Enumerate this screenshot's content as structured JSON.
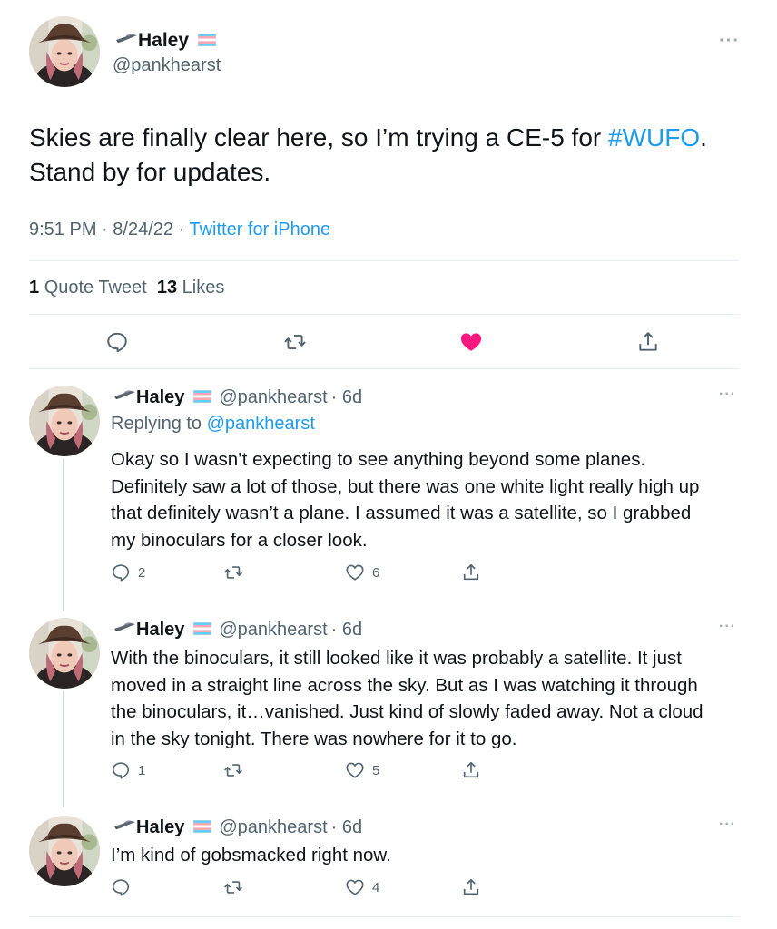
{
  "main_tweet": {
    "name": "Haley",
    "handle": "@pankhearst",
    "text_before": "Skies are finally clear here, so I’m trying a CE-5 for ",
    "hashtag": "#WUFO",
    "text_after": ".",
    "text_line2": "Stand by for updates.",
    "time": "9:51 PM",
    "sep": "·",
    "date": "8/24/22",
    "source": "Twitter for iPhone",
    "quote_count": "1",
    "quote_label": "Quote Tweet",
    "like_count": "13",
    "like_label": "Likes",
    "more": "···"
  },
  "replies": [
    {
      "name": "Haley",
      "handle": "@pankhearst",
      "time": "· 6d",
      "replying_label": "Replying to ",
      "replying_handle": "@pankhearst",
      "lines": [
        "Okay so I wasn’t expecting to see anything beyond some planes.",
        "Definitely saw a lot of those, but there was one white light really high up",
        "that definitely wasn’t a plane. I assumed it was a satellite, so I grabbed",
        "my binoculars for a closer look."
      ],
      "reply_count": "2",
      "like_count": "6"
    },
    {
      "name": "Haley",
      "handle": "@pankhearst",
      "time": "· 6d",
      "lines": [
        "With the binoculars, it still looked like it was probably a satellite. It just",
        "moved in a straight line across the sky. But as I was watching it through",
        "the binoculars, it…vanished. Just kind of slowly faded away. Not a cloud",
        "in the sky tonight. There was nowhere for it to go."
      ],
      "reply_count": "1",
      "like_count": "5"
    },
    {
      "name": "Haley",
      "handle": "@pankhearst",
      "time": "· 6d",
      "lines": [
        "I’m kind of gobsmacked right now."
      ],
      "reply_count": "",
      "like_count": "4"
    }
  ],
  "colors": {
    "link": "#1d9bf0",
    "like_active": "#f91880",
    "secondary_text": "#536471",
    "divider": "#e6ecf0"
  },
  "icons": [
    "ufo-icon",
    "trans-flag-icon",
    "more-icon",
    "reply-icon",
    "retweet-icon",
    "heart-icon",
    "share-icon"
  ]
}
